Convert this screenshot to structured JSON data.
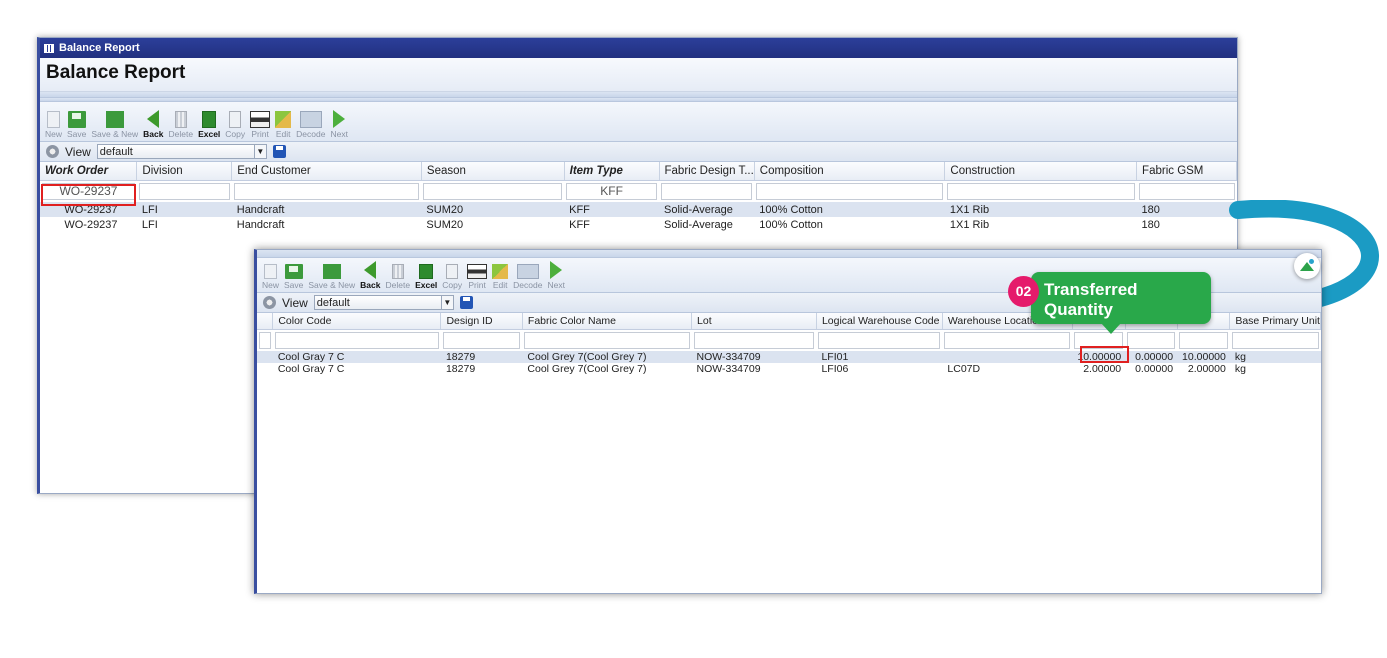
{
  "back_window": {
    "title": "Balance Report",
    "heading": "Balance Report",
    "toolbar": [
      {
        "label": "New",
        "icon": "new-document-icon",
        "enabled": false
      },
      {
        "label": "Save",
        "icon": "save-icon",
        "enabled": false
      },
      {
        "label": "Save & New",
        "icon": "save-new-icon",
        "enabled": false
      },
      {
        "label": "Back",
        "icon": "back-arrow-icon",
        "enabled": true
      },
      {
        "label": "Delete",
        "icon": "delete-icon",
        "enabled": false
      },
      {
        "label": "Excel",
        "icon": "excel-icon",
        "enabled": true
      },
      {
        "label": "Copy",
        "icon": "copy-icon",
        "enabled": false
      },
      {
        "label": "Print",
        "icon": "print-icon",
        "enabled": false
      },
      {
        "label": "Edit",
        "icon": "edit-icon",
        "enabled": false
      },
      {
        "label": "Decode",
        "icon": "decode-icon",
        "enabled": false
      },
      {
        "label": "Next",
        "icon": "next-arrow-icon",
        "enabled": false
      }
    ],
    "view_label": "View",
    "view_value": "default",
    "columns": [
      "Work Order",
      "Division",
      "End Customer",
      "Season",
      "Item Type",
      "Fabric Design T...",
      "Composition",
      "Construction",
      "Fabric GSM"
    ],
    "filters": [
      "WO-29237",
      "",
      "",
      "",
      "KFF",
      "",
      "",
      "",
      ""
    ],
    "rows": [
      [
        "WO-29237",
        "LFI",
        "Handcraft",
        "SUM20",
        "KFF",
        "Solid-Average",
        "100% Cotton",
        "1X1 Rib",
        "180"
      ],
      [
        "WO-29237",
        "LFI",
        "Handcraft",
        "SUM20",
        "KFF",
        "Solid-Average",
        "100% Cotton",
        "1X1 Rib",
        "180"
      ]
    ]
  },
  "front_window": {
    "toolbar": [
      {
        "label": "New",
        "icon": "new-document-icon",
        "enabled": false
      },
      {
        "label": "Save",
        "icon": "save-icon",
        "enabled": false
      },
      {
        "label": "Save & New",
        "icon": "save-new-icon",
        "enabled": false
      },
      {
        "label": "Back",
        "icon": "back-arrow-icon",
        "enabled": true
      },
      {
        "label": "Delete",
        "icon": "delete-icon",
        "enabled": false
      },
      {
        "label": "Excel",
        "icon": "excel-icon",
        "enabled": true
      },
      {
        "label": "Copy",
        "icon": "copy-icon",
        "enabled": false
      },
      {
        "label": "Print",
        "icon": "print-icon",
        "enabled": false
      },
      {
        "label": "Edit",
        "icon": "edit-icon",
        "enabled": false
      },
      {
        "label": "Decode",
        "icon": "decode-icon",
        "enabled": false
      },
      {
        "label": "Next",
        "icon": "next-arrow-icon",
        "enabled": false
      }
    ],
    "view_label": "View",
    "view_value": "default",
    "columns": [
      "Color Code",
      "Design ID",
      "Fabric Color Name",
      "Lot",
      "Logical Warehouse Code",
      "Warehouse Location Code",
      "",
      "",
      "",
      "Base Primary Unit"
    ],
    "rows": [
      [
        "Cool Gray 7 C",
        "18279",
        "Cool Grey 7(Cool Grey 7)",
        "NOW-334709",
        "LFI01",
        "",
        "10.00000",
        "0.00000",
        "10.00000",
        "kg"
      ],
      [
        "Cool Gray 7 C",
        "18279",
        "Cool Grey 7(Cool Grey 7)",
        "NOW-334709",
        "LFI06",
        "LC07D",
        "2.00000",
        "0.00000",
        "2.00000",
        "kg"
      ]
    ]
  },
  "callout": {
    "step": "02",
    "text": "Transferred Quantity",
    "color": "#29a84a",
    "badge_color": "#e51a6b"
  },
  "colors": {
    "title_bar": "#2c3f9a",
    "highlight_box": "#e02020",
    "arrow": "#1b9bc4"
  }
}
